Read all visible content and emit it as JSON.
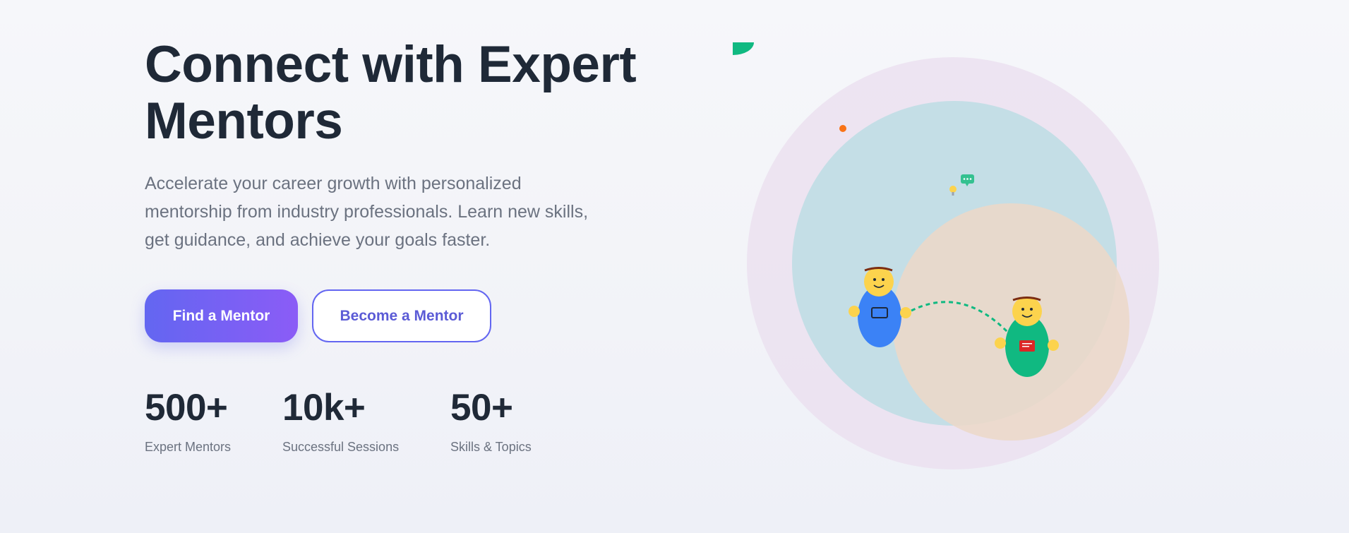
{
  "hero": {
    "title": "Connect with Expert Mentors",
    "subtitle": "Accelerate your career growth with personalized mentorship from industry professionals. Learn new skills, get guidance, and achieve your goals faster."
  },
  "actions": {
    "primary_label": "Find a Mentor",
    "secondary_label": "Become a Mentor"
  },
  "stats": [
    {
      "value": "500+",
      "label": "Expert Mentors"
    },
    {
      "value": "10k+",
      "label": "Successful Sessions"
    },
    {
      "value": "50+",
      "label": "Skills & Topics"
    }
  ],
  "illustration": {
    "icons": [
      "mentor-figure-icon",
      "mentee-figure-icon",
      "chat-bubble-icon",
      "lightbulb-icon",
      "laptop-icon",
      "book-icon"
    ],
    "colors": {
      "outer_circle": "#ebe0f0",
      "inner_circle": "#c4dee6",
      "peach_circle": "#ecd8c8",
      "mentor_body": "#3b82f6",
      "mentee_body": "#10b981",
      "head": "#fcd34d",
      "accent_orange": "#f97316",
      "accent_green": "#10b981"
    }
  },
  "theme": {
    "primary_start": "#6366f1",
    "primary_end": "#8b5cf6",
    "heading_color": "#1f2937",
    "text_color": "#6b7280"
  }
}
